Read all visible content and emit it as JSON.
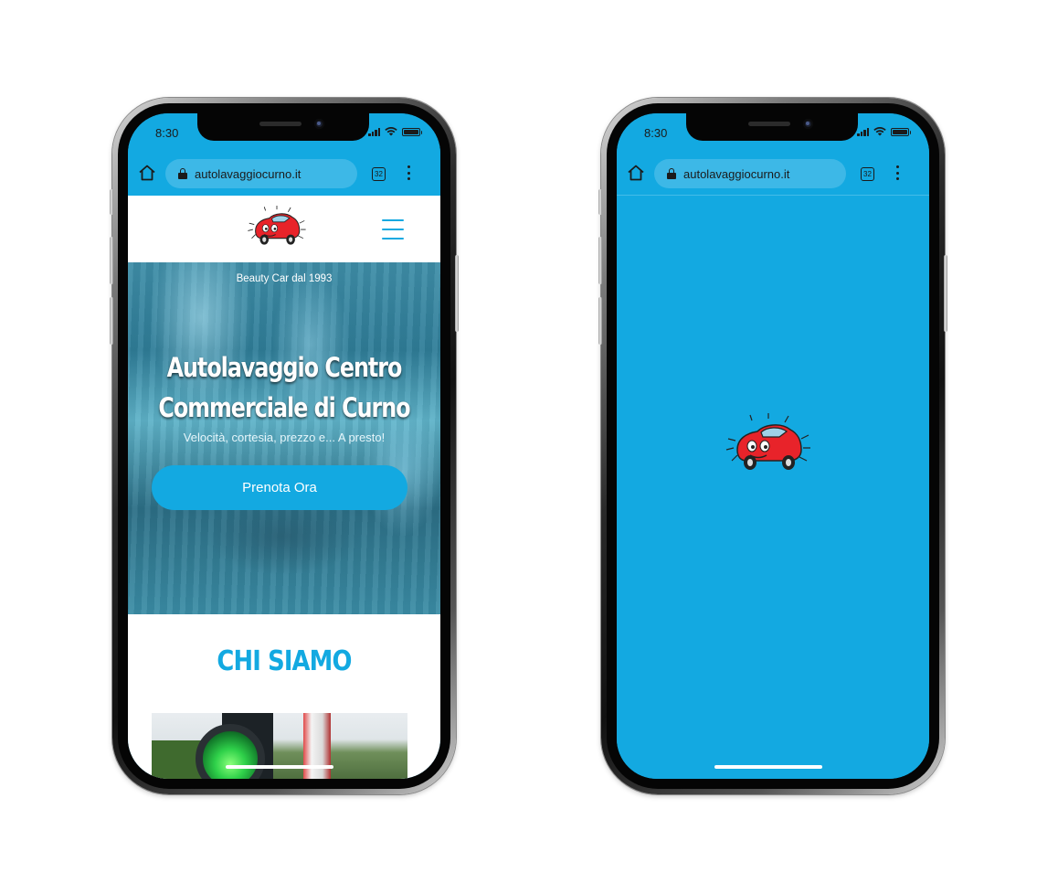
{
  "left_phone": {
    "status": {
      "time": "8:30"
    },
    "browser": {
      "url": "autolavaggiocurno.it",
      "tab_count": "32"
    },
    "hero": {
      "small_title": "Beauty Car dal 1993",
      "title": "Autolavaggio Centro Commerciale di Curno",
      "subtitle": "Velocità, cortesia, prezzo e... A presto!",
      "cta_label": "Prenota Ora"
    },
    "about": {
      "title": "CHI SIAMO"
    }
  },
  "right_phone": {
    "status": {
      "time": "8:30"
    },
    "browser": {
      "url": "autolavaggiocurno.it",
      "tab_count": "32"
    }
  },
  "colors": {
    "brand_blue": "#13a9e1",
    "logo_red": "#e8232a",
    "hero_text": "#ffffff"
  },
  "icons": [
    "home-icon",
    "lock-icon",
    "tabs-icon",
    "more-vert-icon",
    "hamburger-icon",
    "car-logo-icon",
    "signal-icon",
    "wifi-icon",
    "battery-icon"
  ]
}
